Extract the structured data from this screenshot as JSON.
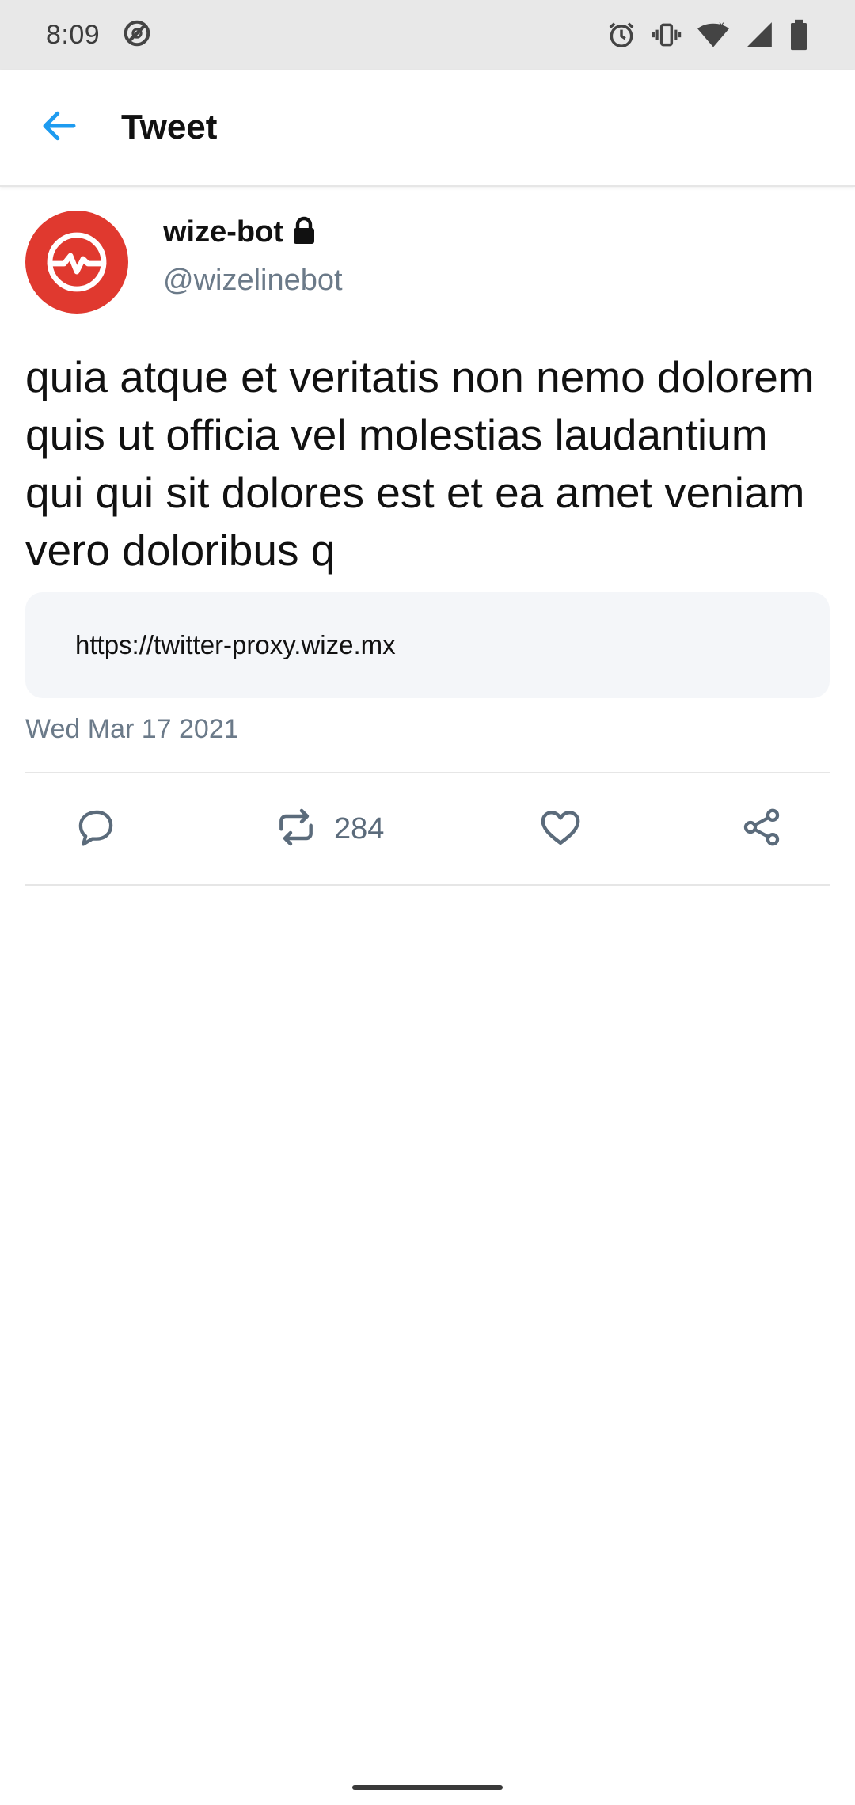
{
  "status_bar": {
    "time": "8:09",
    "icons": [
      "do-not-disturb-icon",
      "alarm-icon",
      "vibrate-icon",
      "wifi-icon",
      "cell-signal-icon",
      "battery-icon"
    ]
  },
  "app_bar": {
    "title": "Tweet",
    "back_icon": "arrow-left-icon",
    "accent_color": "#1d9bf0"
  },
  "tweet": {
    "author": {
      "name": "wize-bot",
      "handle": "@wizelinebot",
      "protected_icon": "lock-icon",
      "avatar_color": "#e0392f"
    },
    "text": "quia atque et veritatis non nemo dolorem quis ut officia vel molestias laudantium qui qui sit dolores est et ea amet veniam vero doloribus q",
    "link": "https://twitter-proxy.wize.mx",
    "date": "Wed Mar 17 2021",
    "actions": {
      "reply_icon": "reply-icon",
      "retweet_icon": "retweet-icon",
      "retweet_count": "284",
      "like_icon": "heart-icon",
      "share_icon": "share-icon"
    }
  },
  "colors": {
    "secondary_text": "#6b7a89",
    "card_background": "#f4f6f9"
  }
}
